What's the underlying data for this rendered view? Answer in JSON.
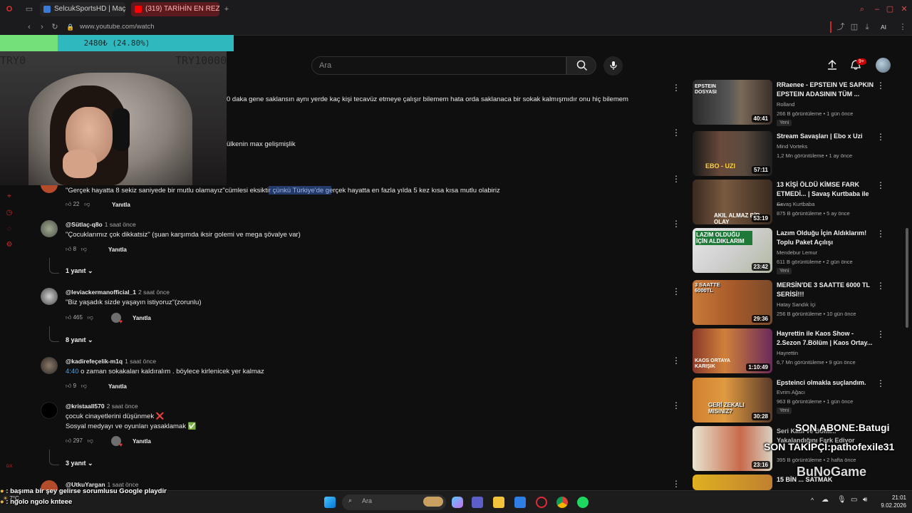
{
  "browser": {
    "tabs": [
      {
        "label": "SelcukSportsHD | Maç",
        "active": false
      },
      {
        "label": "(319) TARİHİN EN REZİL B...",
        "active": true
      }
    ],
    "url": "www.youtube.com/watch",
    "ai_label": "AI"
  },
  "youtube": {
    "search_placeholder": "Ara",
    "notification_count": "9+"
  },
  "comments": [
    {
      "text": "0 daka gene saklansın aynı yerde kaç kişi tecavüz etmeye çalışır bilemem hata orda saklanaca bir sokak kalmışmıdır onu hiç bilemem"
    },
    {
      "text": "ülkenin max gelişmişlik"
    },
    {
      "text": "\"Gerçek hayatta 8 sekiz saniyede bir mutlu olamayız\"cümlesi eksiktir çünkü Türkiye'de gerçek hayatta en fazla yılda 5 kez kısa kısa mutlu olabiriz",
      "likes": "22",
      "reply": "Yanıtla"
    },
    {
      "author": "@Sütlaç-q8o",
      "time": "1 saat önce",
      "text": "\"Çocuklarımız çok dikkatsiz\" (şuan karşımda iksir golemi ve mega şövalye var)",
      "likes": "8",
      "reply": "Yanıtla",
      "replies": "1 yanıt"
    },
    {
      "author": "@leviackermanofficial_1",
      "time": "2 saat önce",
      "text": "\"Biz yaşadık sizde yaşayın istiyoruz\"(zorunlu)",
      "likes": "465",
      "reply": "Yanıtla",
      "replies": "8 yanıt"
    },
    {
      "author": "@kadirefeçelik-m1q",
      "time": "1 saat önce",
      "timestamp_link": "4:40",
      "text": " o zaman sokakaları kaldıralım . böylece kirlenicek yer kalmaz",
      "likes": "9",
      "reply": "Yanıtla"
    },
    {
      "author": "@kristaall570",
      "time": "2 saat önce",
      "text": "çocuk cinayetlerini düşünmek ❌",
      "text2": "Sosyal medyayı ve oyunları yasaklamak ✅",
      "likes": "297",
      "reply": "Yanıtla",
      "replies": "3 yanıt"
    },
    {
      "author": "@UtkuYargan",
      "time": "1 saat önce"
    }
  ],
  "sidebar": [
    {
      "title": "RRaenee - EPSTEIN VE SAPKIN EPSTEIN ADASININ TÜM ...",
      "channel": "Rolland",
      "meta": "266 B görüntüleme • 1 gün önce",
      "duration": "40:41",
      "badge": "Yeni",
      "thumb_text": "EPSTEIN DOSYASI"
    },
    {
      "title": "Stream Savaşları | Ebo x Uzi",
      "channel": "Mind Vorteks",
      "meta": "1,2 Mn görüntüleme • 1 ay önce",
      "duration": "57:11",
      "thumb_text": "EBO - UZI"
    },
    {
      "title": "13 KİŞİ ÖLDÜ KİMSE FARK ETMEDİ... | Savaş Kurtbaba ile ...",
      "channel": "Savaş Kurtbaba",
      "meta": "875 B görüntüleme • 5 ay önce",
      "duration": "53:19",
      "thumb_text": "AKIL ALMAZ BİR OLAY"
    },
    {
      "title": "Lazım Olduğu İçin Aldıklarım! Toplu Paket Açılışı",
      "channel": "Mendebur Lemur",
      "meta": "611 B görüntüleme • 2 gün önce",
      "duration": "23:42",
      "badge": "Yeni",
      "thumb_text": "LAZIM OLDUĞU İÇİN ALDIKLARIM"
    },
    {
      "title": "MERSİN'DE 3 SAATTE 6000 TL SERİSİ!!!",
      "channel": "Hatay Sandık İçi",
      "meta": "256 B görüntüleme • 10 gün önce",
      "duration": "29:36",
      "thumb_text": "3 SAATTE 6000TL"
    },
    {
      "title": "Hayrettin ile Kaos Show - 2.Sezon 7.Bölüm | Kaos Ortay...",
      "channel": "Hayrettin",
      "meta": "6,7 Mn görüntüleme • 9 gün önce",
      "duration": "1:10:49",
      "thumb_text": "KAOS ORTAYA KARIŞIK"
    },
    {
      "title": "Epsteinci olmakla suçlandım.",
      "channel": "Evrim Ağacı",
      "meta": "963 B görüntüleme • 1 gün önce",
      "duration": "30:28",
      "badge": "Yeni",
      "thumb_text": "GERİ ZEKALI MISINIZ?"
    },
    {
      "title": "Seri Katil ve Bolla... Yakalandığını Fark Ediyor",
      "channel": "",
      "meta": "395 B görüntüleme • 2 hafta önce",
      "duration": "23:16",
      "thumb_text": ""
    },
    {
      "title": "15 BİN ... SATMAK",
      "channel": "",
      "meta": "",
      "duration": "",
      "thumb_text": ""
    }
  ],
  "overlay": {
    "progress_text": "2480₺ (24.80%)",
    "progress_fraction": 0.248,
    "goal_start": "TRY0",
    "goal_end": "TRY10000",
    "last_sub": "SON ABONE:Batugi",
    "last_follower": "SON TAKİPÇİ:pathofexile31",
    "watermark": "BuNoGame",
    "chat": [
      {
        "user": "",
        "text": ": başıma bir şey gelirse sorumlusu Google playdir"
      },
      {
        "user": "",
        "text": ": ngolo ngolo knteee"
      }
    ]
  },
  "taskbar": {
    "search_placeholder": "Ara",
    "weather": "7°C",
    "time": "21:01",
    "date": "9.02.2026"
  },
  "colors": {
    "bg": "#0f0f0f",
    "progress_fill": "#73e07a",
    "progress_bg": "#2fb9bf",
    "accent_red": "#c62a2a",
    "link_blue": "#3ea6ff"
  }
}
